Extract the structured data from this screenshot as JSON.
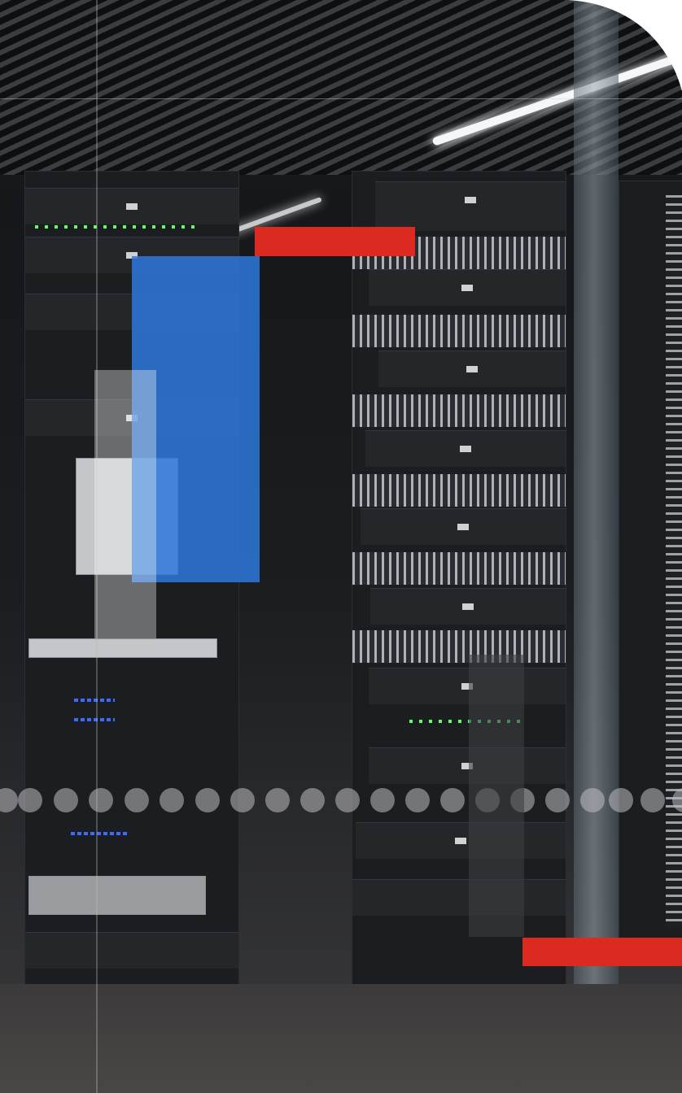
{
  "scene": {
    "subject": "server-racks-photo",
    "colors": {
      "accent_red": "#dc2a20",
      "accent_blue": "#2d78dc",
      "overlay_white": "#ffffff"
    }
  }
}
